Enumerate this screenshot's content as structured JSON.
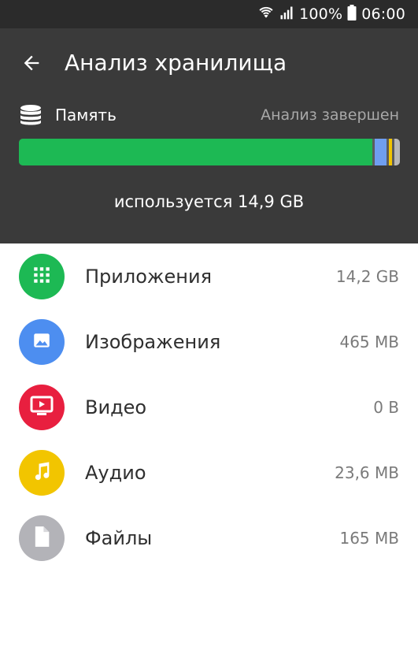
{
  "status_bar": {
    "battery_percent": "100%",
    "time": "06:00"
  },
  "header": {
    "title": "Анализ хранилища",
    "memory_label": "Память",
    "analysis_status": "Анализ завершен",
    "used_text": "используется 14,9 GB"
  },
  "storage_bar": {
    "background_color": "#5c5c5c",
    "segments": [
      {
        "name": "apps",
        "fraction": 0.932,
        "color": "#1db954"
      },
      {
        "name": "images",
        "fraction": 0.03,
        "color": "#6f9ef0"
      },
      {
        "name": "audio",
        "fraction": 0.009,
        "color": "#f2c500"
      },
      {
        "name": "files",
        "fraction": 0.014,
        "color": "#b7b7b7"
      }
    ]
  },
  "categories": [
    {
      "label": "Приложения",
      "size": "14,2 GB",
      "icon": "apps-grid-icon",
      "color": "#1db954"
    },
    {
      "label": "Изображения",
      "size": "465 MB",
      "icon": "image-icon",
      "color": "#4d8ef0"
    },
    {
      "label": "Видео",
      "size": "0 B",
      "icon": "video-icon",
      "color": "#e81f3f"
    },
    {
      "label": "Аудио",
      "size": "23,6 MB",
      "icon": "music-note-icon",
      "color": "#f2c500"
    },
    {
      "label": "Файлы",
      "size": "165 MB",
      "icon": "file-icon",
      "color": "#b3b3b8"
    }
  ]
}
